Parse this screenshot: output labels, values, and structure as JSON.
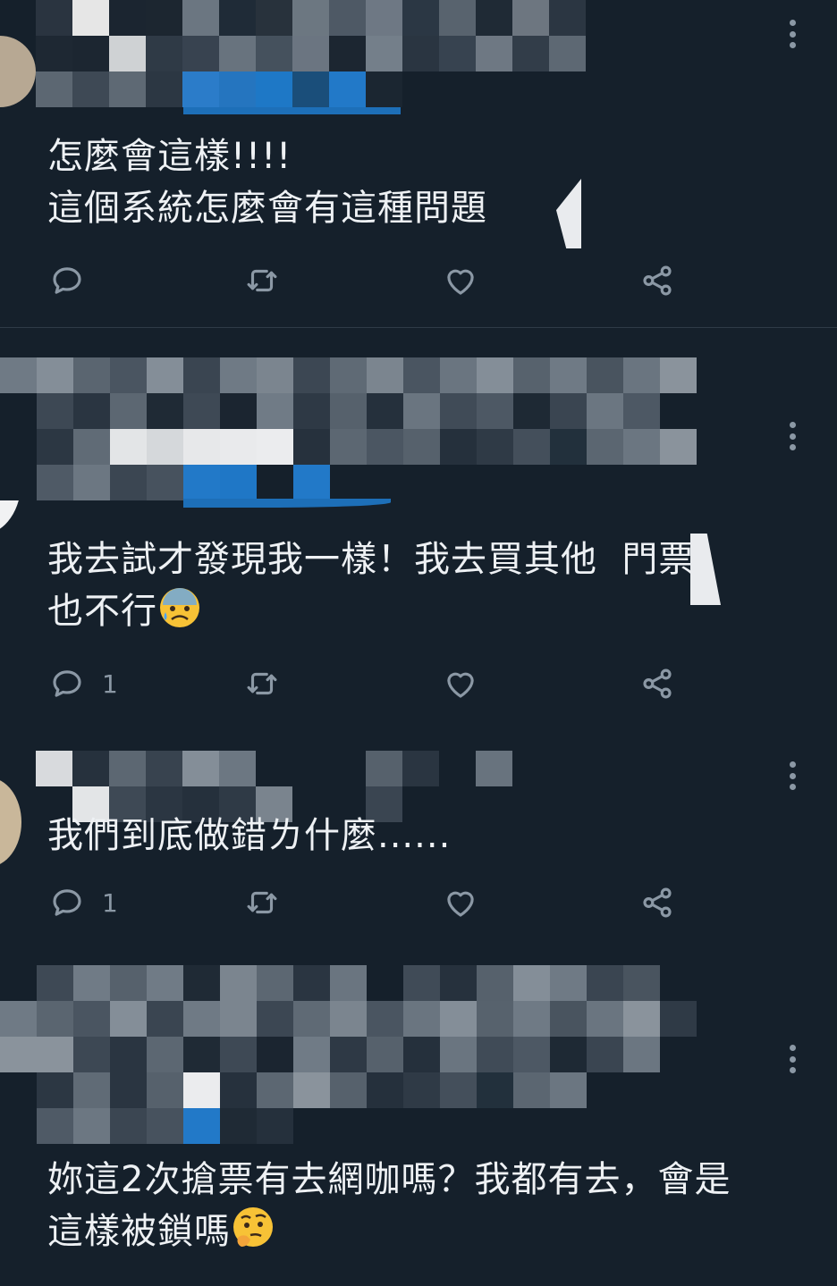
{
  "tweets": [
    {
      "text": "怎麼會這樣!!!!\n這個系統怎麼會有這種問題",
      "reply_count": "",
      "emoji": ""
    },
    {
      "text": "我去試才發現我一樣！我去買其他  門票\n也不行",
      "reply_count": "1",
      "emoji": "anxious-face-with-sweat-icon"
    },
    {
      "text": "我們到底做錯ㄌ什麼......",
      "reply_count": "1",
      "emoji": ""
    },
    {
      "text": "妳這2次搶票有去網咖嗎？我都有去，會是\n這樣被鎖嗎",
      "reply_count": "",
      "emoji": "thinking-face-icon"
    }
  ],
  "icons": {
    "reply": "reply-icon",
    "retweet": "retweet-icon",
    "like": "heart-icon",
    "share": "share-icon",
    "more": "more-vertical-icon"
  },
  "colors": {
    "background": "#15202b",
    "icon": "#8b98a5",
    "text": "#eef1f4",
    "divider": "#2f3b47"
  }
}
